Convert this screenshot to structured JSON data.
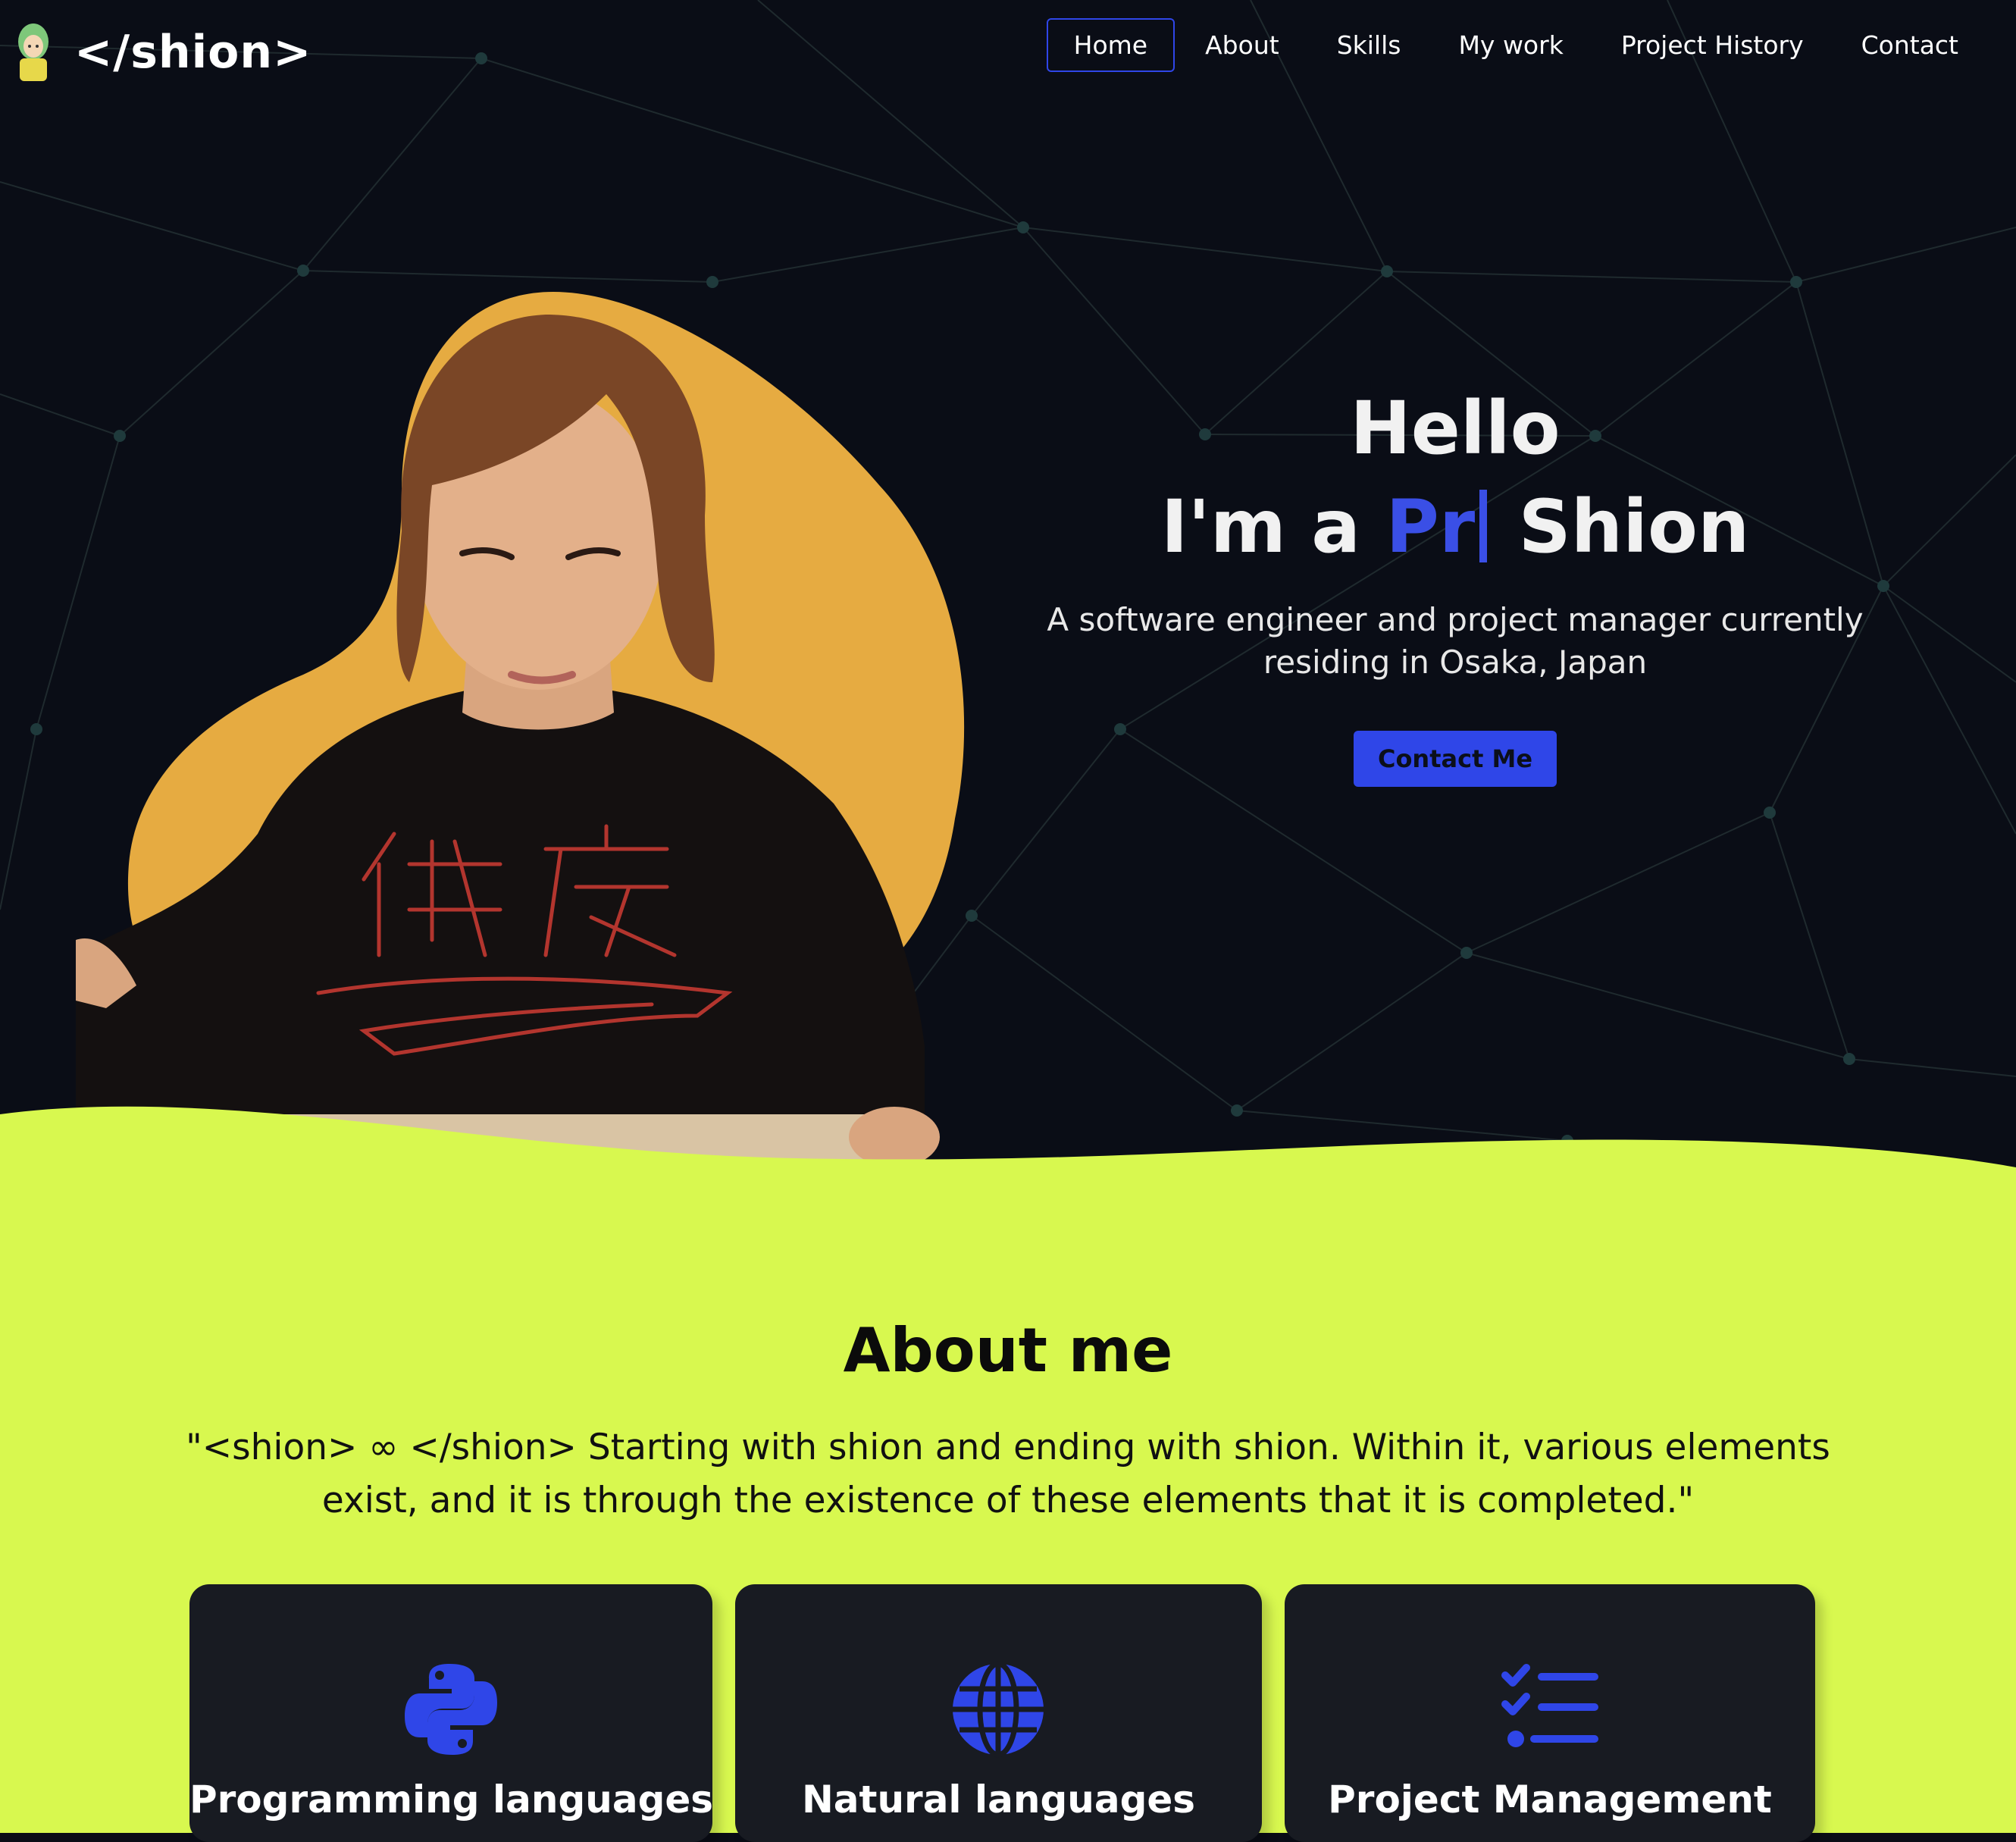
{
  "header": {
    "logo_text": "</shion>",
    "avatar_icon": "avatar-illustration",
    "nav": [
      {
        "label": "Home",
        "active": true
      },
      {
        "label": "About"
      },
      {
        "label": "Skills"
      },
      {
        "label": "My work"
      },
      {
        "label": "Project History"
      },
      {
        "label": "Contact"
      }
    ]
  },
  "hero": {
    "greeting": "Hello",
    "typed_prefix": "I'm a",
    "typed_text": "Pr",
    "typed_suffix": "Shion",
    "subtitle": "A software engineer and project manager currently residing in Osaka, Japan",
    "cta_label": "Contact Me"
  },
  "about": {
    "title": "About me",
    "quote": "\"<shion> ∞ </shion> Starting with shion and ending with shion. Within it, various elements exist, and it is through the existence of these elements that it is completed.\"",
    "cards": [
      {
        "title": "Programming languages",
        "icon": "python-icon"
      },
      {
        "title": "Natural languages",
        "icon": "globe-icon"
      },
      {
        "title": "Project Management",
        "icon": "checklist-icon"
      }
    ]
  },
  "colors": {
    "background": "#0a0d16",
    "accent": "#2f46e8",
    "highlight": "#d8f84f",
    "blob": "#e6a93f",
    "card": "#181b22"
  }
}
